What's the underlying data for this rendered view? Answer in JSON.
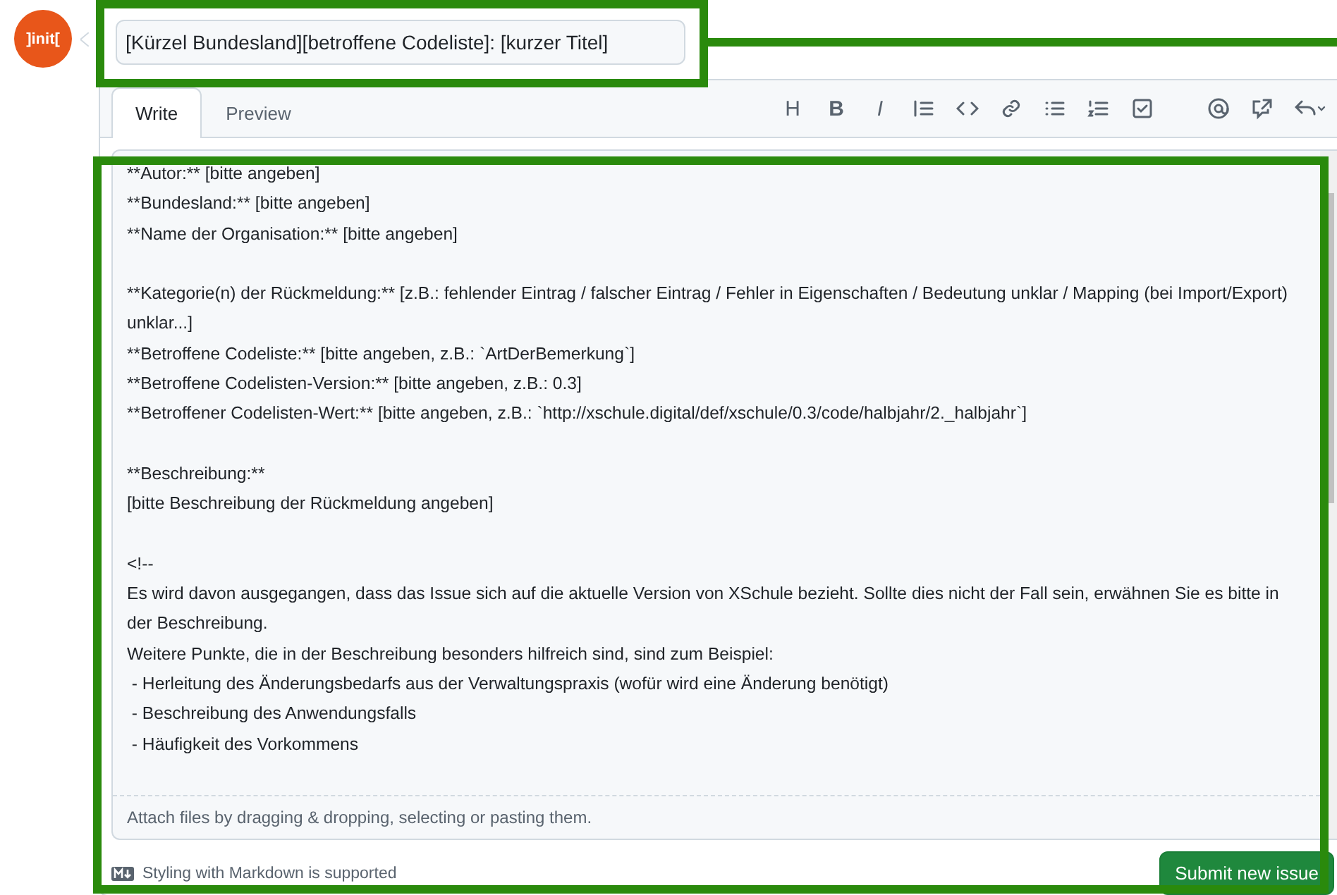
{
  "avatar": {
    "label": "]init["
  },
  "title_field": {
    "value": "[Kürzel Bundesland][betroffene Codeliste]: [kurzer Titel]"
  },
  "tabs": [
    {
      "label": "Write",
      "selected": true
    },
    {
      "label": "Preview",
      "selected": false
    }
  ],
  "toolbar_glyphs": [
    "H",
    "B",
    "I"
  ],
  "editor_blocks": [
    [
      "**Autor:** [bitte angeben]",
      "**Bundesland:** [bitte angeben]",
      "**Name der Organisation:** [bitte angeben]"
    ],
    [
      "**Kategorie(n) der Rückmeldung:** [z.B.: fehlender Eintrag / falscher Eintrag / Fehler in Eigenschaften / Bedeutung unklar / Mapping (bei Import/Export) unklar...]",
      "**Betroffene Codeliste:** [bitte angeben, z.B.: `ArtDerBemerkung`]",
      "**Betroffene Codelisten-Version:** [bitte angeben, z.B.: 0.3]",
      "**Betroffener Codelisten-Wert:** [bitte angeben, z.B.: `http://xschule.digital/def/xschule/0.3/code/halbjahr/2._halbjahr`]"
    ],
    [
      "**Beschreibung:**",
      "[bitte Beschreibung der Rückmeldung angeben]"
    ],
    [
      "<!--",
      "Es wird davon ausgegangen, dass das Issue sich auf die aktuelle Version von XSchule bezieht. Sollte dies nicht der Fall sein, erwähnen Sie es bitte in der Beschreibung.",
      "Weitere Punkte, die in der Beschreibung besonders hilfreich sind, sind zum Beispiel:",
      " - Herleitung des Änderungsbedarfs aus der Verwaltungspraxis (wofür wird eine Änderung benötigt)",
      " - Beschreibung des Anwendungsfalls",
      " - Häufigkeit des Vorkommens"
    ]
  ],
  "attach_hint": "Attach files by dragging & dropping, selecting or pasting them.",
  "markdown_note": "Styling with Markdown is supported",
  "submit_button": "Submit new issue"
}
